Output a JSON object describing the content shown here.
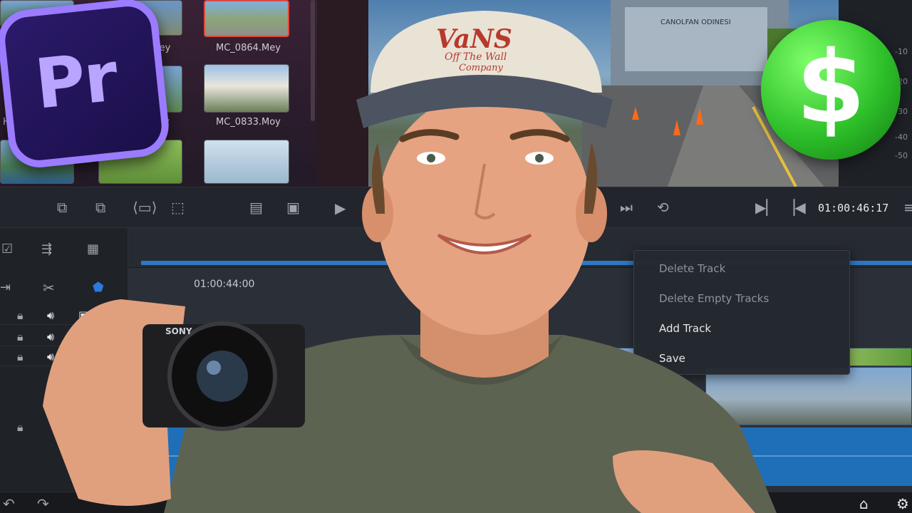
{
  "media_pool": {
    "thumbnails": [
      {
        "label": "2.Mey"
      },
      {
        "label": "MC_0864.Mey"
      },
      {
        "label": "HC"
      },
      {
        "label": "ey"
      },
      {
        "label": "MC_0833.Moy"
      }
    ]
  },
  "viewer": {
    "sign_text": "CANOLFAN ODINESI"
  },
  "audio_meter": {
    "labels": [
      "-10",
      "-20",
      "-30",
      "-40",
      "-50"
    ]
  },
  "transport": {
    "timecode": "01:00:46:17"
  },
  "timeline": {
    "ruler_time": "01:00:44:00"
  },
  "context_menu": {
    "items": [
      {
        "label": "Delete Track",
        "enabled": false
      },
      {
        "label": "Delete Empty Tracks",
        "enabled": false
      },
      {
        "label": "Add Track",
        "enabled": true
      },
      {
        "label": "Save",
        "enabled": true
      }
    ]
  },
  "badges": {
    "premiere_text": "Pr",
    "dollar_text": "$"
  },
  "cap_text": {
    "line1": "VaNS",
    "line2": "Off The Wall",
    "line3": "Company"
  },
  "camera_brand": "SONY",
  "colors": {
    "accent_blue": "#2f78c4",
    "selected_red": "#e0483c",
    "premiere_purple": "#9b7bff",
    "dollar_green": "#2ec02a"
  }
}
